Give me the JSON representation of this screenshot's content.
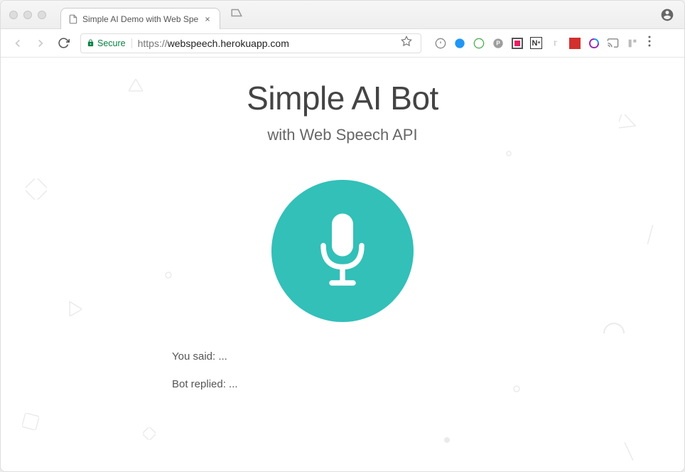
{
  "browser": {
    "tab": {
      "title": "Simple AI Demo with Web Spe"
    },
    "address": {
      "secure_label": "Secure",
      "protocol": "https://",
      "domain": "webspeech.herokuapp.com"
    }
  },
  "page": {
    "title": "Simple AI Bot",
    "subtitle": "with Web Speech API",
    "you_said_label": "You said: ",
    "you_said_value": "...",
    "bot_replied_label": "Bot replied: ",
    "bot_replied_value": "..."
  },
  "colors": {
    "accent": "#32c0b8",
    "secure_green": "#0b8043"
  }
}
